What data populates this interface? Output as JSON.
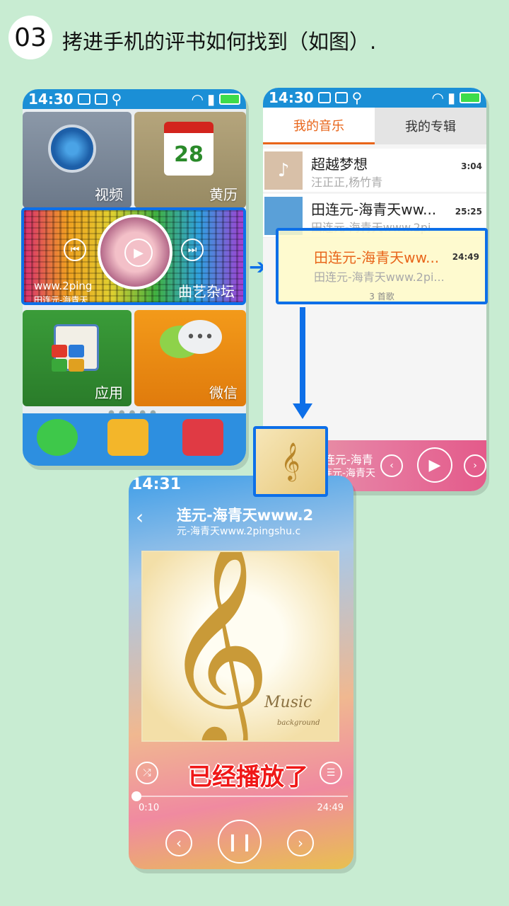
{
  "step": {
    "number": "03",
    "title": "拷进手机的评书如何找到（如图）."
  },
  "phone1": {
    "time": "14:30",
    "tiles": {
      "video": "视频",
      "calendar": "黄历",
      "calendar_day": "28",
      "apps": "应用",
      "wechat": "微信"
    },
    "music_tile": {
      "site": "www.2ping",
      "subtitle": "田连元-海青天",
      "label": "曲艺杂坛"
    }
  },
  "phone2": {
    "time": "14:30",
    "tabs": [
      "我的音乐",
      "我的专辑"
    ],
    "songs": [
      {
        "title": "超越梦想",
        "artist": "汪正正,杨竹青",
        "duration": "3:04"
      },
      {
        "title": "田连元-海青天ww...",
        "artist": "田连元-海青天www.2pi",
        "duration": "25:25"
      }
    ],
    "highlight": {
      "title": "田连元-海青天ww...",
      "artist": "田连元-海青天www.2pi...",
      "duration": "24:49",
      "count": "3 首歌"
    },
    "mini_player": {
      "line1": "田连元-海青",
      "line2": "田连元-海青天"
    }
  },
  "phone3": {
    "time": "14:31",
    "title": "连元-海青天www.2",
    "subtitle": "元-海青天www.2pingshu.c",
    "cover_text": "Music",
    "cover_subtext": "background",
    "status": "已经播放了",
    "time_current": "0:10",
    "time_total": "24:49"
  }
}
